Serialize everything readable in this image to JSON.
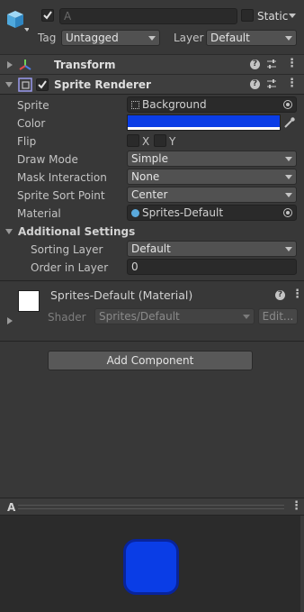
{
  "gameobject": {
    "name_placeholder": "A",
    "static_label": "Static",
    "tag_label": "Tag",
    "tag_value": "Untagged",
    "layer_label": "Layer",
    "layer_value": "Default"
  },
  "transform": {
    "title": "Transform"
  },
  "sprite_renderer": {
    "title": "Sprite Renderer",
    "sprite_label": "Sprite",
    "sprite_value": "Background",
    "color_label": "Color",
    "color_value": "#0a3de6",
    "flip_label": "Flip",
    "flip_x": "X",
    "flip_y": "Y",
    "draw_mode_label": "Draw Mode",
    "draw_mode_value": "Simple",
    "mask_label": "Mask Interaction",
    "mask_value": "None",
    "sort_point_label": "Sprite Sort Point",
    "sort_point_value": "Center",
    "material_label": "Material",
    "material_value": "Sprites-Default",
    "additional_settings": "Additional Settings",
    "sorting_layer_label": "Sorting Layer",
    "sorting_layer_value": "Default",
    "order_label": "Order in Layer",
    "order_value": "0"
  },
  "material": {
    "title": "Sprites-Default (Material)",
    "shader_label": "Shader",
    "shader_value": "Sprites/Default",
    "edit_label": "Edit..."
  },
  "add_component_label": "Add Component",
  "preview": {
    "title": "A",
    "sprite_color": "#0a3de6"
  }
}
